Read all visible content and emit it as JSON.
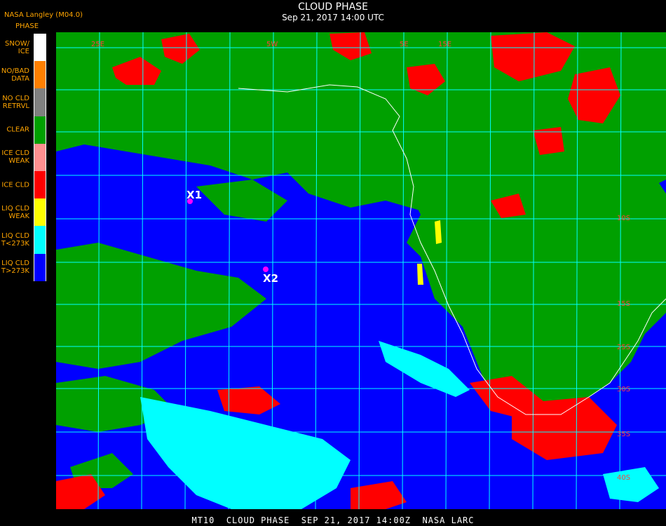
{
  "header": {
    "title": "CLOUD PHASE",
    "subtitle": "Sep 21, 2017 14:00 UTC",
    "org": "NASA Langley (M04.0)"
  },
  "legend": {
    "title": "PHASE",
    "items": [
      {
        "label": "SNOW/\nICE",
        "color": "#ffffff"
      },
      {
        "label": "NO/BAD\nDATA",
        "color": "#ff8000"
      },
      {
        "label": "NO CLD\nRETRVL",
        "color": "#808080"
      },
      {
        "label": "CLEAR",
        "color": "#00a000"
      },
      {
        "label": "ICE CLD\nWEAK",
        "color": "#ff9090"
      },
      {
        "label": "ICE CLD",
        "color": "#ff0000"
      },
      {
        "label": "LIQ CLD\nWEAK",
        "color": "#ffff00"
      },
      {
        "label": "LIQ CLD\nT<273K",
        "color": "#00ffff"
      },
      {
        "label": "LIQ CLD\nT>273K",
        "color": "#0000ff"
      }
    ]
  },
  "map": {
    "markers": [
      {
        "label": "X1"
      },
      {
        "label": "X2"
      }
    ],
    "grid_labels": [
      "25E",
      "15E",
      "5E",
      "5W",
      "10S",
      "15S",
      "25S",
      "30S",
      "35S",
      "40S"
    ],
    "colors": {
      "ocean": "#0000ff",
      "land": "#00a000",
      "ice": "#ff0000",
      "liq_cold": "#00ffff",
      "grid": "#00ffff",
      "marker": "#ff00ff"
    }
  },
  "footer": {
    "text": "MT10  CLOUD PHASE  SEP 21, 2017 14:00Z  NASA LARC"
  }
}
